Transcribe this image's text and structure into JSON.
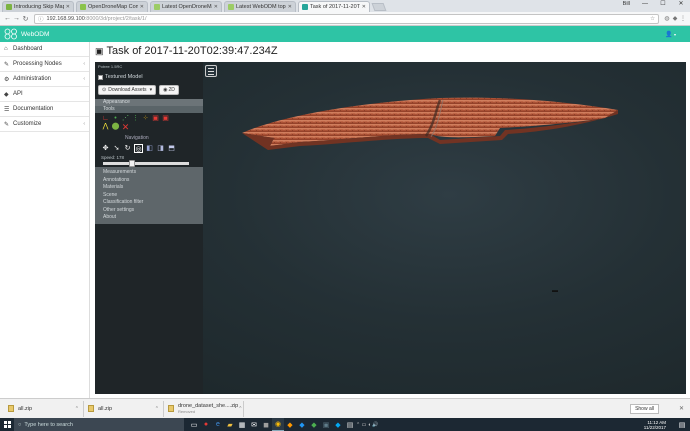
{
  "browser": {
    "tabs": [
      {
        "title": "Introducing Skip Maps!",
        "color": "#7cb342",
        "active": false
      },
      {
        "title": "OpenDroneMap Comm",
        "color": "#8bc34a",
        "active": false
      },
      {
        "title": "Latest OpenDroneMap b",
        "color": "#9ccc65",
        "active": false
      },
      {
        "title": "Latest WebODM topics",
        "color": "#9ccc65",
        "active": false
      },
      {
        "title": "Task of 2017-11-20T02",
        "color": "#26a69a",
        "active": true
      }
    ],
    "user": "Bill",
    "url_host": "192.168.99.100",
    "url_path": ":8000/3d/project/2/task/1/",
    "window_controls": {
      "minimize": "—",
      "maximize": "☐",
      "close": "✕"
    }
  },
  "topnav": {
    "brand": "WebODM",
    "user_icon": "user-icon"
  },
  "sidebar": {
    "items": [
      {
        "label": "Dashboard",
        "icon": "⌂",
        "caret": false
      },
      {
        "label": "Processing Nodes",
        "icon": "✎",
        "caret": true
      },
      {
        "label": "Administration",
        "icon": "⚙",
        "caret": true
      },
      {
        "label": "API",
        "icon": "◆",
        "caret": false
      },
      {
        "label": "Documentation",
        "icon": "☰",
        "caret": false
      },
      {
        "label": "Customize",
        "icon": "✎",
        "caret": true
      }
    ]
  },
  "page": {
    "title": "Task of 2017-11-20T02:39:47.234Z"
  },
  "viewer": {
    "panel_title": "Potree 1.5RC",
    "textured_model_label": "Textured Model",
    "download_assets_label": "Download Assets",
    "view_2d_label": "2D",
    "sections": {
      "appearance": "Appearance",
      "tools": "Tools",
      "navigation": "Navigation"
    },
    "speed_label": "Speed: 178",
    "speed_value": 0.3,
    "menu_items": [
      "Measurements",
      "Annotations",
      "Materials",
      "Scene",
      "Classification filter",
      "Other settings",
      "About"
    ]
  },
  "downloads": {
    "items": [
      {
        "name": "all.zip",
        "sub": ""
      },
      {
        "name": "all.zip",
        "sub": ""
      },
      {
        "name": "drone_dataset_she....zip",
        "sub": "Removed"
      }
    ],
    "show_all": "Show all"
  },
  "taskbar": {
    "search_placeholder": "Type here to search",
    "time": "11:12 AM",
    "date": "11/22/2017"
  }
}
